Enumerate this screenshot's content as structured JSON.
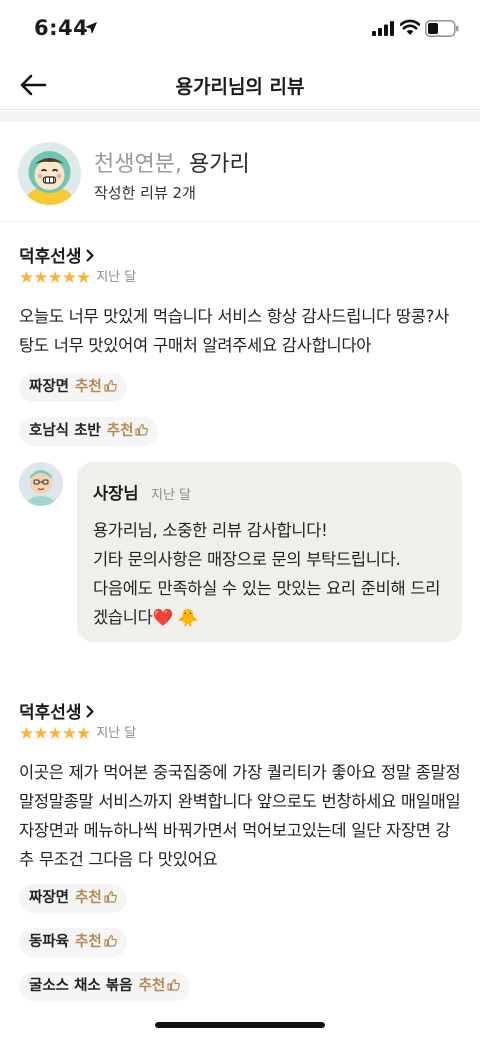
{
  "status_bar": {
    "time": "6:44"
  },
  "nav": {
    "title": "용가리님의 리뷰"
  },
  "profile": {
    "grade": "천생연분,",
    "nickname": "용가리",
    "review_count": "작성한 리뷰 2개"
  },
  "reviews": [
    {
      "store": "덕후선생",
      "stars": "★★★★★",
      "date": "지난 달",
      "text": "오늘도 너무 맛있게 먹습니다 서비스 항상 감사드립니다 땅콩?사탕도 너무 맛있어여 구매처 알려주세요 감사합니다아",
      "menus": [
        {
          "name": "짜장면",
          "recommend": "추천"
        },
        {
          "name": "호남식 초반",
          "recommend": "추천"
        }
      ],
      "owner_reply": {
        "name": "사장님",
        "date": "지난 달",
        "lines": [
          "용가리님, 소중한 리뷰 감사합니다!",
          "기타 문의사항은 매장으로 문의 부탁드립니다.",
          "다음에도 만족하실 수 있는 맛있는 요리 준비해 드리겠습니다",
          "❤️",
          "🐥"
        ]
      }
    },
    {
      "store": "덕후선생",
      "stars": "★★★★★",
      "date": "지난 달",
      "text": "이곳은 제가 먹어본 중국집중에 가장 퀄리티가 좋아요 정말 종말정말정말종말 서비스까지 완벽합니다 앞으로도 번창하세요 매일매일 자장면과 메뉴하나씩 바꿔가면서 먹어보고있는데 일단 자장면 강추 무조건 그다음 다 맛있어요",
      "menus": [
        {
          "name": "짜장면",
          "recommend": "추천"
        },
        {
          "name": "동파육",
          "recommend": "추천"
        },
        {
          "name": "굴소스 채소 볶음",
          "recommend": "추천"
        }
      ]
    }
  ],
  "colors": {
    "star": "#f6b53b",
    "recommend": "#b38a52",
    "reply_bg": "#f1efea"
  }
}
